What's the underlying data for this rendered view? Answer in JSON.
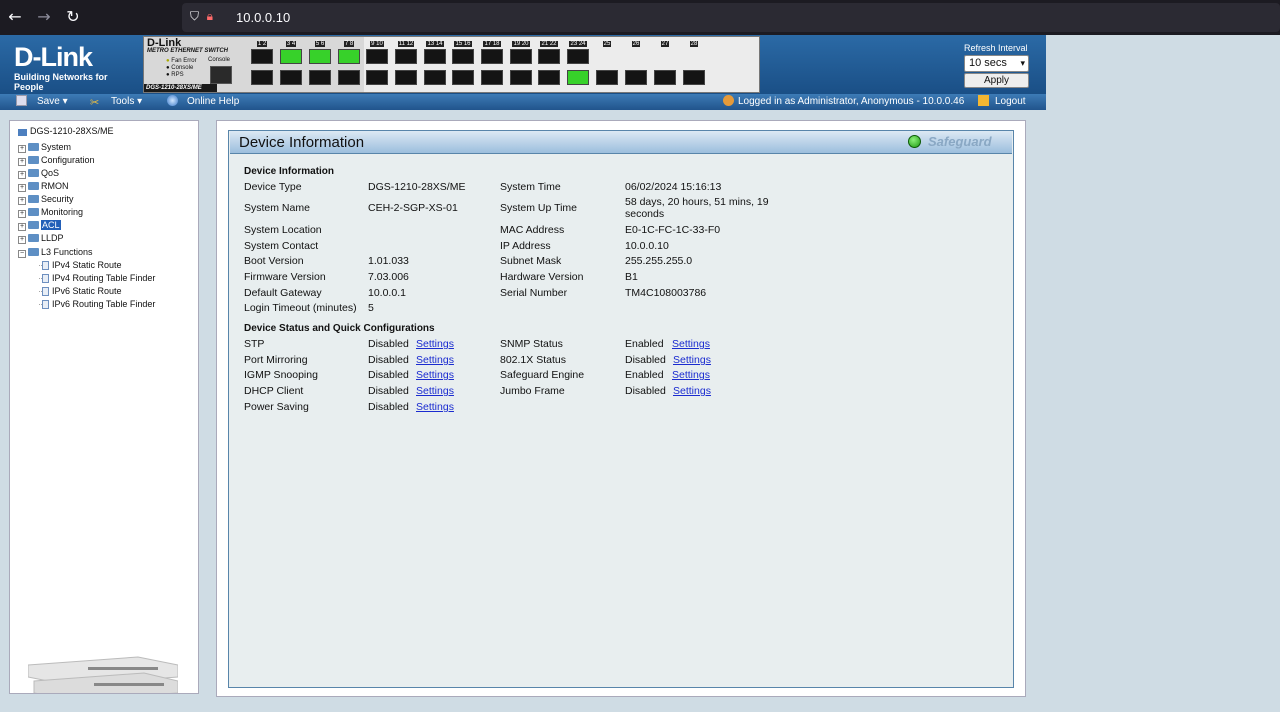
{
  "browser": {
    "url": "10.0.0.10"
  },
  "header": {
    "logo": "D-Link",
    "logo_tagline": "Building Networks for People",
    "panel": {
      "model": "D-Link",
      "subtitle": "METRO ETHERNET SWITCH",
      "leds": [
        "Fan Error",
        "Console",
        "RPS"
      ],
      "console_label": "Console",
      "model_name": "DGS-1210-28XS/ME",
      "port_labels": [
        "1 2",
        "3 4",
        "5 6",
        "7 8",
        "9 10",
        "11 12",
        "13 14",
        "15 16",
        "17 18",
        "19 20",
        "21 22",
        "23 24",
        "25",
        "26",
        "27",
        "28"
      ],
      "active_ports": [
        3,
        5,
        7,
        24
      ]
    },
    "refresh_label": "Refresh Interval",
    "refresh_value": "10 secs",
    "apply_label": "Apply"
  },
  "toolbar": {
    "save": "Save",
    "tools": "Tools",
    "help": "Online Help",
    "logged_in": "Logged in as Administrator, Anonymous - 10.0.0.46",
    "logout": "Logout"
  },
  "tree": {
    "root": "DGS-1210-28XS/ME",
    "folders": [
      "System",
      "Configuration",
      "QoS",
      "RMON",
      "Security",
      "Monitoring",
      "ACL",
      "LLDP"
    ],
    "selected": "ACL",
    "expanded": "L3 Functions",
    "children": [
      "IPv4 Static Route",
      "IPv4 Routing Table Finder",
      "IPv6 Static Route",
      "IPv6 Routing Table Finder"
    ]
  },
  "main": {
    "title": "Device Information",
    "safeguard": "Safeguard",
    "info_heading": "Device Information",
    "status_heading": "Device Status and Quick Configurations",
    "info_left": [
      {
        "label": "Device Type",
        "value": "DGS-1210-28XS/ME"
      },
      {
        "label": "System Name",
        "value": "CEH-2-SGP-XS-01"
      },
      {
        "label": "System Location",
        "value": ""
      },
      {
        "label": "System Contact",
        "value": ""
      },
      {
        "label": "Boot Version",
        "value": "1.01.033"
      },
      {
        "label": "Firmware Version",
        "value": "7.03.006"
      },
      {
        "label": "Default Gateway",
        "value": "10.0.0.1"
      },
      {
        "label": "Login Timeout (minutes)",
        "value": "5"
      }
    ],
    "info_right": [
      {
        "label": "System Time",
        "value": "06/02/2024 15:16:13"
      },
      {
        "label": "System Up Time",
        "value": "58 days, 20 hours, 51 mins, 19 seconds"
      },
      {
        "label": "MAC Address",
        "value": "E0-1C-FC-1C-33-F0"
      },
      {
        "label": "IP Address",
        "value": "10.0.0.10"
      },
      {
        "label": "Subnet Mask",
        "value": "255.255.255.0"
      },
      {
        "label": "Hardware Version",
        "value": "B1"
      },
      {
        "label": "Serial Number",
        "value": "TM4C108003786"
      }
    ],
    "status_left": [
      {
        "label": "STP",
        "value": "Disabled",
        "link": "Settings"
      },
      {
        "label": "Port Mirroring",
        "value": "Disabled",
        "link": "Settings"
      },
      {
        "label": "IGMP Snooping",
        "value": "Disabled",
        "link": "Settings"
      },
      {
        "label": "DHCP Client",
        "value": "Disabled",
        "link": "Settings"
      },
      {
        "label": "Power Saving",
        "value": "Disabled",
        "link": "Settings"
      }
    ],
    "status_right": [
      {
        "label": "SNMP Status",
        "value": "Enabled",
        "link": "Settings"
      },
      {
        "label": "802.1X Status",
        "value": "Disabled",
        "link": "Settings"
      },
      {
        "label": "Safeguard Engine",
        "value": "Enabled",
        "link": "Settings"
      },
      {
        "label": "Jumbo Frame",
        "value": "Disabled",
        "link": "Settings"
      }
    ]
  }
}
